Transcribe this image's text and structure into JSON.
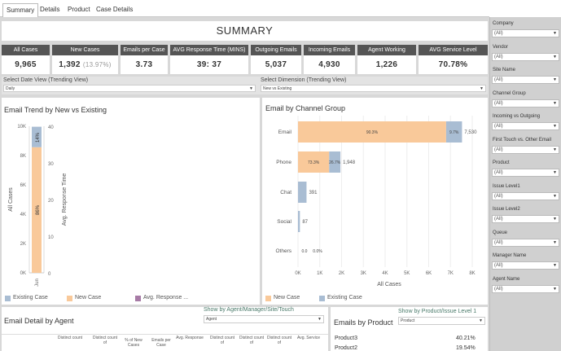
{
  "tabs": [
    "Summary",
    "Details",
    "Product",
    "Case Details"
  ],
  "summary_title": "SUMMARY",
  "kpis": [
    {
      "label": "All Cases",
      "value": "9,965",
      "sub": ""
    },
    {
      "label": "New Cases",
      "value": "1,392",
      "sub": "(13.97%)"
    },
    {
      "label": "Emails per Case",
      "value": "3.73",
      "sub": ""
    },
    {
      "label": "AVG Response Time (MINS)",
      "value": "39: 37",
      "sub": ""
    },
    {
      "label": "Outgoing Emails",
      "value": "5,037",
      "sub": ""
    },
    {
      "label": "Incoming Emails",
      "value": "4,930",
      "sub": ""
    },
    {
      "label": "Agent Working",
      "value": "1,226",
      "sub": ""
    },
    {
      "label": "AVG Service Level",
      "value": "70.78%",
      "sub": ""
    }
  ],
  "filters": {
    "date_view_label": "Select Date View (Trending View)",
    "date_view_value": "Daily",
    "dimension_label": "Select Dimension (Trending View)",
    "dimension_value": "New vs Existing"
  },
  "trend": {
    "title": "Email Trend by New vs Existing",
    "y_label": "All Cases",
    "y2_label": "Avg. Response Time",
    "y_ticks": [
      "10K",
      "8K",
      "6K",
      "4K",
      "2K",
      "0K"
    ],
    "y2_ticks": [
      "40",
      "30",
      "20",
      "10",
      "0"
    ],
    "x_tick": "Jun",
    "bar_labels": [
      "14%",
      "86%"
    ],
    "legend": [
      "Existing Case",
      "New Case",
      "Avg. Response ..."
    ]
  },
  "channel": {
    "title": "Email by Channel Group",
    "x_label": "All Cases",
    "x_ticks": [
      "0K",
      "1K",
      "2K",
      "3K",
      "4K",
      "5K",
      "6K",
      "7K",
      "8K"
    ],
    "legend": [
      "New Case",
      "Existing Case"
    ]
  },
  "agent": {
    "title": "Email Detail by Agent",
    "show_by_label": "Show by Agent/Manager/Site/Touch",
    "show_by_value": "Agent",
    "columns": [
      "Distinct count",
      "Distinct count of",
      "% of New Cases",
      "Emails per Case",
      "Avg. Response",
      "Distinct count of",
      "Distinct count of",
      "Distinct count of",
      "Avg. Service"
    ]
  },
  "product": {
    "title": "Emails by Product",
    "show_by_label": "Show by Product/Issue Level 1",
    "show_by_value": "Product",
    "rows": [
      {
        "name": "Product3",
        "value": "40.21%"
      },
      {
        "name": "Product2",
        "value": "19.54%"
      }
    ]
  },
  "right_filters": [
    {
      "label": "Company",
      "value": "(All)"
    },
    {
      "label": "Vendor",
      "value": "(All)"
    },
    {
      "label": "Site Name",
      "value": "(All)"
    },
    {
      "label": "Channel Group",
      "value": "(All)"
    },
    {
      "label": "Incoming vs Outgoing",
      "value": "(All)"
    },
    {
      "label": "First Touch vs. Other Email",
      "value": "(All)"
    },
    {
      "label": "Product",
      "value": "(All)"
    },
    {
      "label": "Issue Level1",
      "value": "(All)"
    },
    {
      "label": "Issue Level2",
      "value": "(All)"
    },
    {
      "label": "Queue",
      "value": "(All)"
    },
    {
      "label": "Manager Name",
      "value": "(All)"
    },
    {
      "label": "Agent Name",
      "value": "(All)"
    }
  ],
  "colors": {
    "new_case": "#f9c99a",
    "existing_case": "#a9bdd3",
    "avg_response": "#a77ba6",
    "kpi_header": "#555555"
  },
  "chart_data": [
    {
      "type": "bar",
      "title": "Email Trend by New vs Existing",
      "categories": [
        "Jun"
      ],
      "series": [
        {
          "name": "New Case",
          "values": [
            8570
          ]
        },
        {
          "name": "Existing Case",
          "values": [
            1395
          ]
        }
      ],
      "ylabel": "All Cases",
      "ylim": [
        0,
        10000
      ]
    },
    {
      "type": "bar",
      "title": "Email by Channel Group",
      "orientation": "horizontal",
      "categories": [
        "Email",
        "Phone",
        "Chat",
        "Social",
        "Others"
      ],
      "series": [
        {
          "name": "New Case",
          "values": [
            6800,
            1430,
            0,
            0,
            0
          ]
        },
        {
          "name": "Existing Case",
          "values": [
            730,
            518,
            391,
            87,
            0
          ]
        }
      ],
      "segment_labels": [
        [
          "90.3%",
          "9.7%"
        ],
        [
          "73.3%",
          "26.7%"
        ],
        [
          "",
          ""
        ],
        [
          "",
          ""
        ],
        [
          "0.0",
          "0.0%"
        ]
      ],
      "totals": [
        "7,530",
        "1,948",
        "391",
        "87",
        ""
      ],
      "xlabel": "All Cases",
      "xlim": [
        0,
        8000
      ]
    }
  ]
}
